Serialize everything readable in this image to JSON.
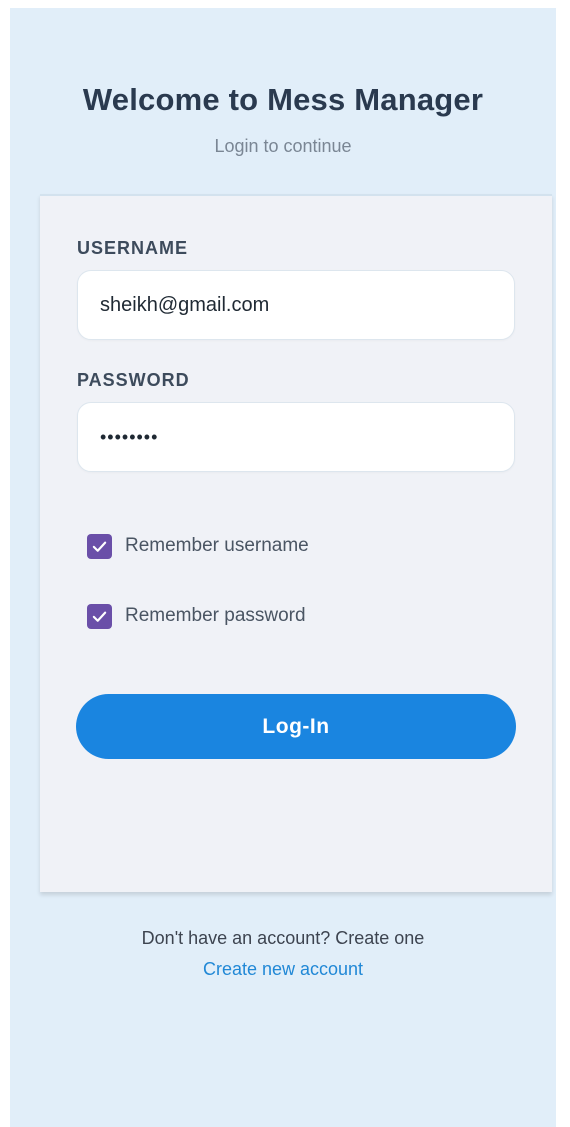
{
  "header": {
    "title": "Welcome to Mess Manager",
    "subtitle": "Login to continue"
  },
  "form": {
    "username_label": "USERNAME",
    "username_value": "sheikh@gmail.com",
    "password_label": "PASSWORD",
    "password_value": "••••••••",
    "remember_username": {
      "label": "Remember username",
      "checked": true
    },
    "remember_password": {
      "label": "Remember password",
      "checked": true
    },
    "login_label": "Log-In"
  },
  "footer": {
    "prompt": "Don't have an account? Create one",
    "link_label": "Create new account"
  },
  "colors": {
    "background": "#e1eef9",
    "card": "#f0f2f7",
    "primary_button": "#1a85e0",
    "checkbox": "#6a4fa8",
    "link": "#2188d6",
    "title": "#2a3a4f"
  }
}
